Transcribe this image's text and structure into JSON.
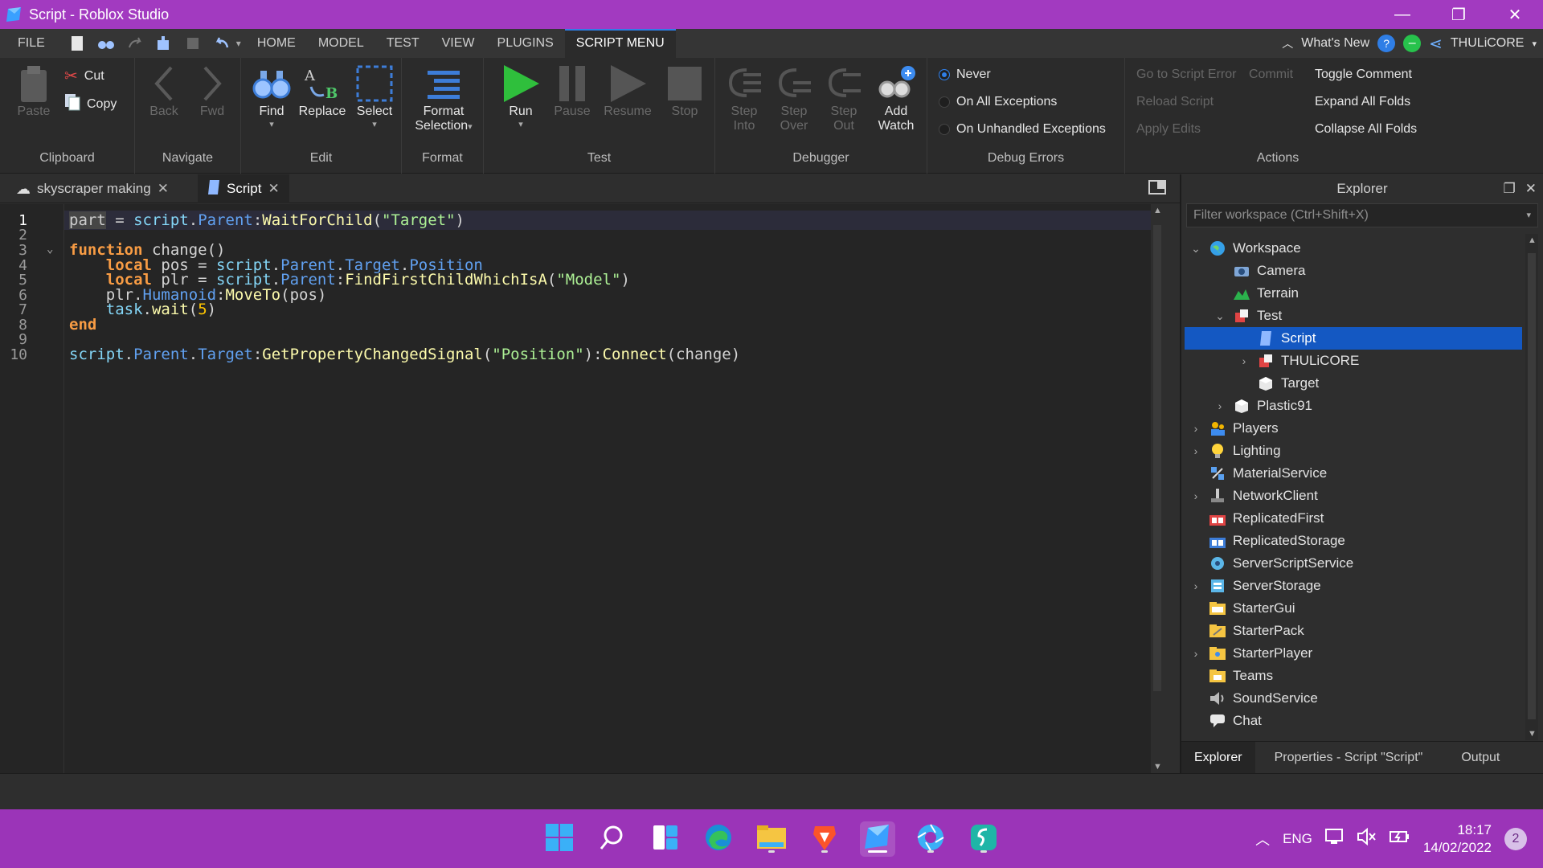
{
  "window": {
    "title": "Script - Roblox Studio"
  },
  "menu": {
    "file": "FILE",
    "tabs": [
      "HOME",
      "MODEL",
      "TEST",
      "VIEW",
      "PLUGINS",
      "SCRIPT MENU"
    ],
    "whats_new": "What's New",
    "user": "THULiCORE"
  },
  "ribbon": {
    "clipboard": {
      "paste": "Paste",
      "cut": "Cut",
      "copy": "Copy",
      "label": "Clipboard"
    },
    "navigate": {
      "back": "Back",
      "fwd": "Fwd",
      "label": "Navigate"
    },
    "edit": {
      "find": "Find",
      "replace": "Replace",
      "select": "Select",
      "label": "Edit"
    },
    "format": {
      "format_line1": "Format",
      "format_line2": "Selection",
      "label": "Format"
    },
    "test": {
      "run": "Run",
      "pause": "Pause",
      "resume": "Resume",
      "stop": "Stop",
      "label": "Test"
    },
    "debugger": {
      "step_into_1": "Step",
      "step_into_2": "Into",
      "step_over_1": "Step",
      "step_over_2": "Over",
      "step_out_1": "Step",
      "step_out_2": "Out",
      "add_watch_1": "Add",
      "add_watch_2": "Watch",
      "label": "Debugger"
    },
    "debug_errors": {
      "never": "Never",
      "all": "On All Exceptions",
      "unhandled": "On Unhandled Exceptions",
      "label": "Debug Errors"
    },
    "actions": {
      "goto_error": "Go to Script Error",
      "commit": "Commit",
      "reload": "Reload Script",
      "apply": "Apply Edits",
      "toggle_comment": "Toggle Comment",
      "expand": "Expand All Folds",
      "collapse": "Collapse All Folds",
      "label": "Actions"
    }
  },
  "doc_tabs": [
    {
      "label": "skyscraper making"
    },
    {
      "label": "Script"
    }
  ],
  "editor": {
    "line_numbers": [
      "1",
      "2",
      "3",
      "4",
      "5",
      "6",
      "7",
      "8",
      "9",
      "10"
    ],
    "code": {
      "l1_a": "part",
      "l1_b": " = ",
      "l1_c": "script",
      "l1_d": ".",
      "l1_e": "Parent",
      "l1_f": ":",
      "l1_g": "WaitForChild",
      "l1_h": "(",
      "l1_i": "\"Target\"",
      "l1_j": ")",
      "l3_a": "function",
      "l3_b": " change()",
      "l4_a": "    ",
      "l4_b": "local",
      "l4_c": " pos = ",
      "l4_d": "script",
      "l4_e": ".",
      "l4_f": "Parent",
      "l4_g": ".",
      "l4_h": "Target",
      "l4_i": ".",
      "l4_j": "Position",
      "l5_a": "    ",
      "l5_b": "local",
      "l5_c": " plr = ",
      "l5_d": "script",
      "l5_e": ".",
      "l5_f": "Parent",
      "l5_g": ":",
      "l5_h": "FindFirstChildWhichIsA",
      "l5_i": "(",
      "l5_j": "\"Model\"",
      "l5_k": ")",
      "l6_a": "    plr.",
      "l6_b": "Humanoid",
      "l6_c": ":",
      "l6_d": "MoveTo",
      "l6_e": "(pos)",
      "l7_a": "    ",
      "l7_b": "task",
      "l7_c": ".",
      "l7_d": "wait",
      "l7_e": "(",
      "l7_f": "5",
      "l7_g": ")",
      "l8_a": "end",
      "l10_a": "script",
      "l10_b": ".",
      "l10_c": "Parent",
      "l10_d": ".",
      "l10_e": "Target",
      "l10_f": ":",
      "l10_g": "GetPropertyChangedSignal",
      "l10_h": "(",
      "l10_i": "\"Position\"",
      "l10_j": "):",
      "l10_k": "Connect",
      "l10_l": "(change)"
    }
  },
  "explorer": {
    "title": "Explorer",
    "filter_placeholder": "Filter workspace (Ctrl+Shift+X)",
    "nodes": [
      {
        "label": "Workspace"
      },
      {
        "label": "Camera"
      },
      {
        "label": "Terrain"
      },
      {
        "label": "Test"
      },
      {
        "label": "Script"
      },
      {
        "label": "THULiCORE"
      },
      {
        "label": "Target"
      },
      {
        "label": "Plastic91"
      },
      {
        "label": "Players"
      },
      {
        "label": "Lighting"
      },
      {
        "label": "MaterialService"
      },
      {
        "label": "NetworkClient"
      },
      {
        "label": "ReplicatedFirst"
      },
      {
        "label": "ReplicatedStorage"
      },
      {
        "label": "ServerScriptService"
      },
      {
        "label": "ServerStorage"
      },
      {
        "label": "StarterGui"
      },
      {
        "label": "StarterPack"
      },
      {
        "label": "StarterPlayer"
      },
      {
        "label": "Teams"
      },
      {
        "label": "SoundService"
      },
      {
        "label": "Chat"
      }
    ],
    "panel_tabs": [
      "Explorer",
      "Properties - Script \"Script\"",
      "Output"
    ]
  },
  "taskbar": {
    "lang": "ENG",
    "time": "18:17",
    "date": "14/02/2022",
    "notifications": "2"
  },
  "colors": {
    "title_bar": "#a23ac0",
    "taskbar": "#9b34b8",
    "selection": "#1458c2",
    "accent": "#2f7ee6"
  }
}
